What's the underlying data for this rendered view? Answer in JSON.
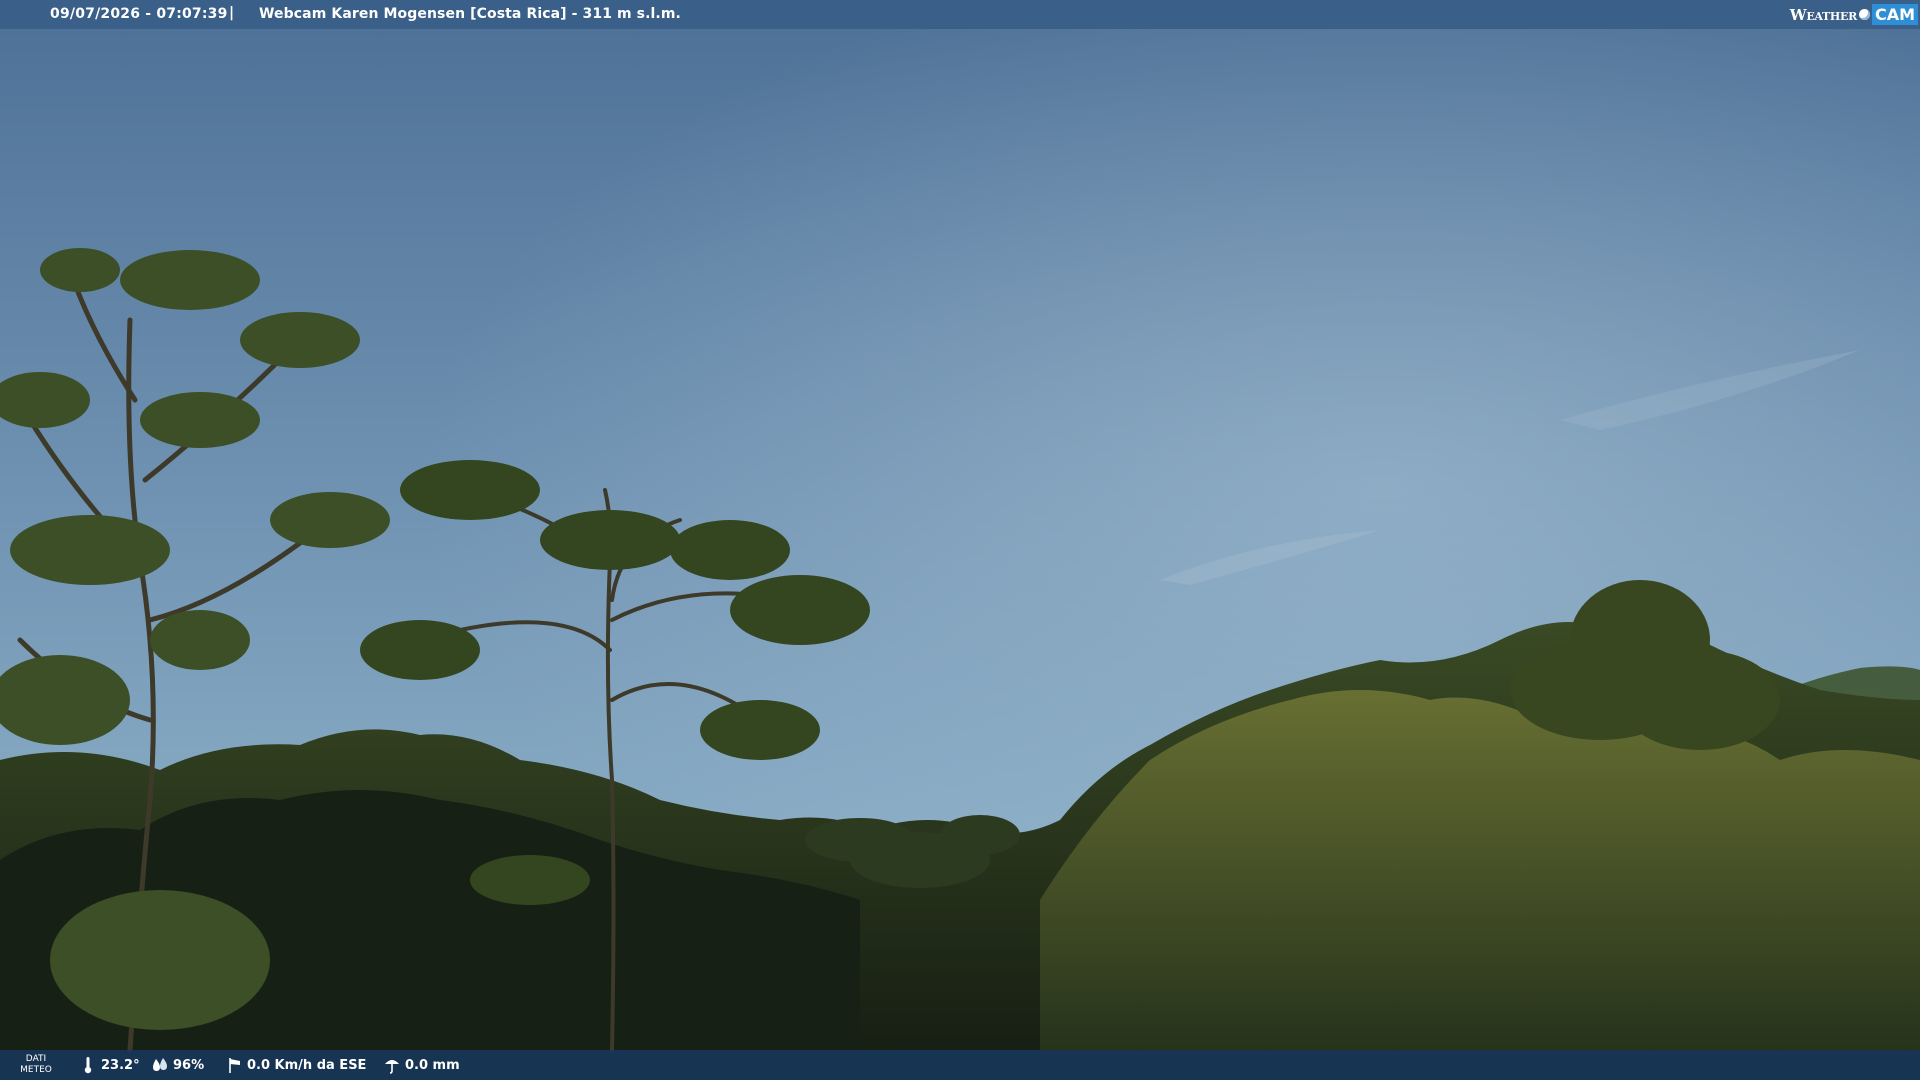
{
  "header": {
    "datetime": "09/07/2026 - 07:07:39",
    "separator": "|",
    "title": "Webcam Karen Mogensen [Costa Rica]  - 311 m s.l.m.",
    "brand": {
      "weather_text": "Weather",
      "cam_text": "CAM"
    }
  },
  "footer": {
    "dati_line1": "DATI",
    "dati_line2": "METEO",
    "temperature": "23.2°",
    "humidity": "96%",
    "wind": "0.0 Km/h da ESE",
    "rain": "0.0 mm"
  },
  "icons": {
    "temperature": "thermometer-icon",
    "humidity": "humidity-icon",
    "wind": "wind-icon",
    "rain": "rain-gauge-icon"
  },
  "colors": {
    "header_bar": "#3a5f88",
    "footer_bar": "#18385c",
    "brand_cam": "#2f8fd6",
    "sky_top": "#4d7096",
    "sky_bottom": "#86a9c3",
    "forest_dark": "#1d2b1a",
    "forest_sunlit": "#5e6a2c"
  }
}
